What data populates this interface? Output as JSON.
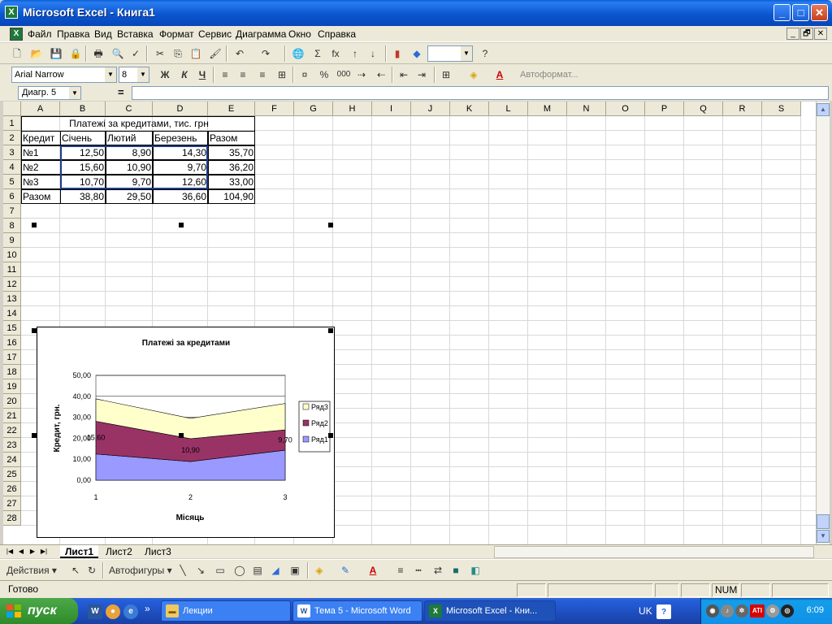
{
  "window": {
    "title": "Microsoft Excel - Книга1",
    "app_icon": "excel-icon",
    "minimize": "_",
    "maximize": "□",
    "close": "✕"
  },
  "menu": {
    "items": [
      "Файл",
      "Правка",
      "Вид",
      "Вставка",
      "Формат",
      "Сервис",
      "Диаграмма",
      "Окно",
      "Справка"
    ],
    "doc_controls": [
      "_",
      "🗗",
      "✕"
    ]
  },
  "toolbar_formatting": {
    "font": "Arial Narrow",
    "size": "8",
    "bold": "Ж",
    "italic": "К",
    "underline": "Ч",
    "percent": "%",
    "thousands": "000",
    "autoformat": "Автоформат..."
  },
  "toolbar_standard": {
    "sigma": "Σ",
    "fx": "fx",
    "help": "?"
  },
  "formula_bar": {
    "name_box": "Диагр. 5",
    "equals": "=",
    "formula": ""
  },
  "grid": {
    "columns": [
      "A",
      "B",
      "C",
      "D",
      "E",
      "F",
      "G",
      "H",
      "I",
      "J",
      "K",
      "L",
      "M",
      "N",
      "O",
      "P",
      "Q",
      "R",
      "S"
    ],
    "rows": [
      "1",
      "2",
      "3",
      "4",
      "5",
      "6",
      "7",
      "8",
      "9",
      "10",
      "11",
      "12",
      "13",
      "14",
      "15",
      "16",
      "17",
      "18",
      "19",
      "20",
      "21",
      "22",
      "23",
      "24",
      "25",
      "26",
      "27",
      "28"
    ],
    "table_title": "Платежі за кредитами, тис. грн",
    "header_row": [
      "Кредит",
      "Січень",
      "Лютий",
      "Березень",
      "Разом"
    ],
    "data_rows": [
      [
        "№1",
        "12,50",
        "8,90",
        "14,30",
        "35,70"
      ],
      [
        "№2",
        "15,60",
        "10,90",
        "9,70",
        "36,20"
      ],
      [
        "№3",
        "10,70",
        "9,70",
        "12,60",
        "33,00"
      ],
      [
        "Разом",
        "38,80",
        "29,50",
        "36,60",
        "104,90"
      ]
    ]
  },
  "chart_data": {
    "type": "area",
    "stacked": true,
    "title": "Платежі за кредитами",
    "xlabel": "Місяць",
    "ylabel": "Кредит, грн.",
    "categories": [
      "1",
      "2",
      "3"
    ],
    "ylim": [
      0,
      50
    ],
    "yticks": [
      "0,00",
      "10,00",
      "20,00",
      "30,00",
      "40,00",
      "50,00"
    ],
    "grid": "horizontal",
    "legend_position": "right",
    "series": [
      {
        "name": "Ряд1",
        "values": [
          12.5,
          8.9,
          14.3
        ],
        "color": "#9999ff"
      },
      {
        "name": "Ряд2",
        "values": [
          15.6,
          10.9,
          9.7
        ],
        "color": "#993366"
      },
      {
        "name": "Ряд3",
        "values": [
          10.7,
          9.7,
          12.6
        ],
        "color": "#ffffcc"
      }
    ],
    "data_labels": [
      "15,60",
      "10,90",
      "9,70"
    ]
  },
  "sheet_tabs": [
    "Лист1",
    "Лист2",
    "Лист3"
  ],
  "active_tab": "Лист1",
  "drawing_toolbar": {
    "actions": "Действия ▾",
    "autoshapes": "Автофигуры ▾"
  },
  "status": {
    "ready": "Готово",
    "num": "NUM"
  },
  "taskbar": {
    "start": "пуск",
    "tasks": [
      "Лекции",
      "Тема 5 - Microsoft Word",
      "Microsoft Excel - Кни..."
    ],
    "language": "UK",
    "clock": "6:09",
    "more": "»"
  }
}
